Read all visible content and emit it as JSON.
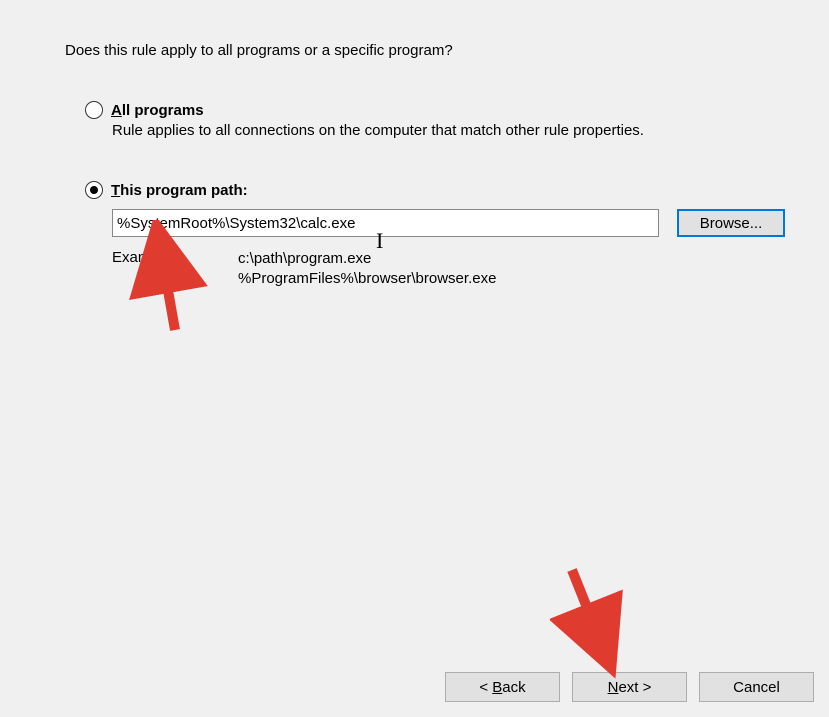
{
  "prompt": "Does this rule apply to all programs or a specific program?",
  "option_all": {
    "label_ul": "A",
    "label_rest": "ll programs",
    "desc": "Rule applies to all connections on the computer that match other rule properties."
  },
  "option_path": {
    "label_ul": "T",
    "label_rest": "his program path:",
    "value": "%SystemRoot%\\System32\\calc.exe",
    "browse": "Browse...",
    "example_label": "Example:",
    "example1": "c:\\path\\program.exe",
    "example2": "%ProgramFiles%\\browser\\browser.exe"
  },
  "buttons": {
    "back_pre": "< ",
    "back_ul": "B",
    "back_rest": "ack",
    "next_ul": "N",
    "next_rest": "ext >",
    "cancel": "Cancel"
  }
}
